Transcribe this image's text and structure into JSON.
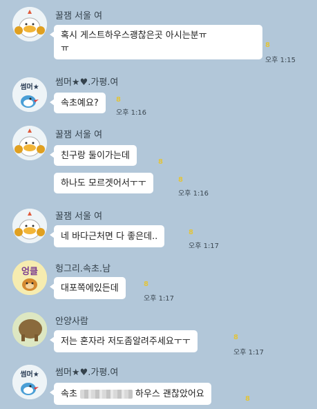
{
  "messages": [
    {
      "sender": "꿀잼 서울 여",
      "bubbles": [
        {
          "text_line1": "혹시 게스트하우스괭찮은곳 아시는분ㅠ",
          "text_line2": "ㅠ",
          "unread": "8",
          "time": "오후 1:15"
        }
      ]
    },
    {
      "sender": "썸머★♥.가평.여",
      "bubbles": [
        {
          "text": "속초예요?",
          "unread": "8",
          "time": "오후 1:16"
        }
      ]
    },
    {
      "sender": "꿀잼 서울 여",
      "bubbles": [
        {
          "text": "친구랑 둘이가는데",
          "unread": "8",
          "time": ""
        },
        {
          "text": "하나도 모르겟어서ㅜㅜ",
          "unread": "8",
          "time": "오후 1:16"
        }
      ]
    },
    {
      "sender": "꿀잼 서울 여",
      "bubbles": [
        {
          "text": "네 바다근처면 다 좋은데..",
          "unread": "8",
          "time": "오후 1:17"
        }
      ]
    },
    {
      "sender": "헝그리.속초.남",
      "avatar_text": "엉클",
      "bubbles": [
        {
          "text": "대포쪽에있든데",
          "unread": "8",
          "time": "오후 1:17"
        }
      ]
    },
    {
      "sender": "안양사람",
      "bubbles": [
        {
          "text": "저는 혼자라 저도좀알려주세요ㅜㅜ",
          "unread": "8",
          "time": "오후 1:17"
        }
      ]
    },
    {
      "sender": "썸머★♥.가평.여",
      "bubbles": [
        {
          "text_before": "속초",
          "text_after": "하우스 괜찮았어요",
          "unread": "8",
          "time": ""
        }
      ]
    }
  ],
  "avatar_labels": {
    "summer": "썸머★"
  },
  "colors": {
    "background": "#b2c7d9",
    "bubble": "#ffffff",
    "unread": "#e2c43b"
  }
}
